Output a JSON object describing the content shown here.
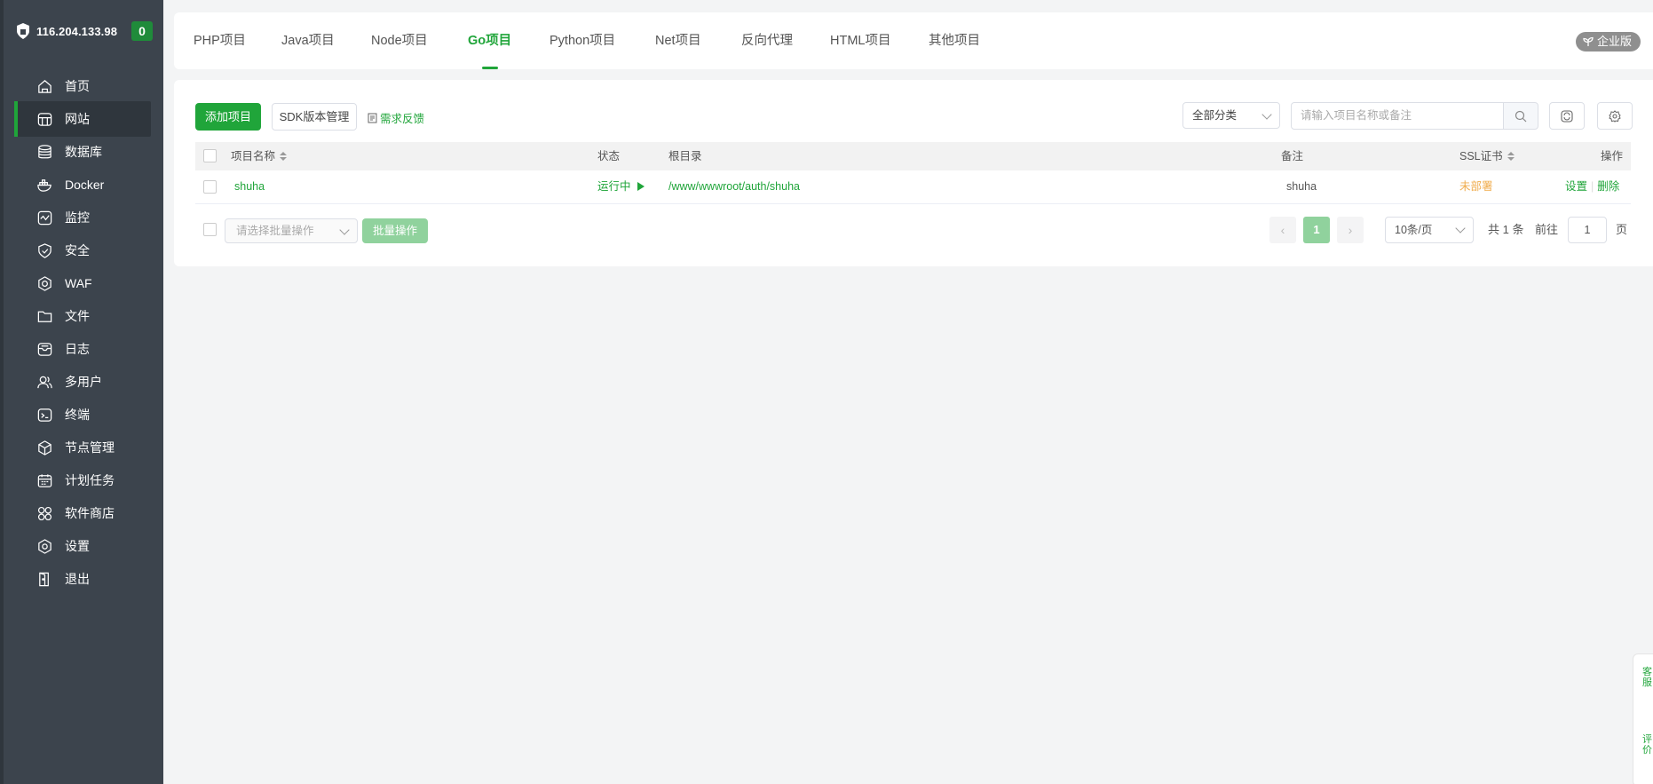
{
  "sidebar": {
    "ip": "116.204.133.98",
    "badge": "0",
    "items": [
      {
        "label": "首页",
        "icon": "home-icon"
      },
      {
        "label": "网站",
        "icon": "website-icon"
      },
      {
        "label": "数据库",
        "icon": "database-icon"
      },
      {
        "label": "Docker",
        "icon": "docker-icon"
      },
      {
        "label": "监控",
        "icon": "monitor-icon"
      },
      {
        "label": "安全",
        "icon": "shield-icon"
      },
      {
        "label": "WAF",
        "icon": "waf-icon"
      },
      {
        "label": "文件",
        "icon": "folder-icon"
      },
      {
        "label": "日志",
        "icon": "log-icon"
      },
      {
        "label": "多用户",
        "icon": "users-icon"
      },
      {
        "label": "终端",
        "icon": "terminal-icon"
      },
      {
        "label": "节点管理",
        "icon": "node-icon"
      },
      {
        "label": "计划任务",
        "icon": "calendar-icon"
      },
      {
        "label": "软件商店",
        "icon": "store-icon"
      },
      {
        "label": "设置",
        "icon": "settings-icon"
      },
      {
        "label": "退出",
        "icon": "logout-icon"
      }
    ],
    "active_index": 1
  },
  "tabs": {
    "items": [
      "PHP项目",
      "Java项目",
      "Node项目",
      "Go项目",
      "Python项目",
      "Net项目",
      "反向代理",
      "HTML项目",
      "其他项目"
    ],
    "active_index": 3,
    "enterprise": "企业版"
  },
  "toolbar": {
    "add": "添加项目",
    "sdk": "SDK版本管理",
    "feedback": "需求反馈",
    "category": "全部分类",
    "search_placeholder": "请输入项目名称或备注"
  },
  "table": {
    "headers": {
      "name": "项目名称",
      "status": "状态",
      "root": "根目录",
      "remark": "备注",
      "ssl": "SSL证书",
      "actions": "操作"
    },
    "rows": [
      {
        "name": "shuha",
        "status": "运行中",
        "root": "/www/wwwroot/auth/shuha",
        "remark": "shuha",
        "ssl": "未部署",
        "action_settings": "设置",
        "action_delete": "删除"
      }
    ]
  },
  "footer": {
    "batch_placeholder": "请选择批量操作",
    "batch_button": "批量操作",
    "page": "1",
    "page_size": "10条/页",
    "total": "共 1 条",
    "goto_label": "前往",
    "goto_value": "1",
    "goto_suffix": "页"
  },
  "float": {
    "service": "客服",
    "review": "评价"
  },
  "colors": {
    "accent": "#20a53a",
    "sidebar": "#3c444d",
    "warning": "#f0ad4e"
  }
}
